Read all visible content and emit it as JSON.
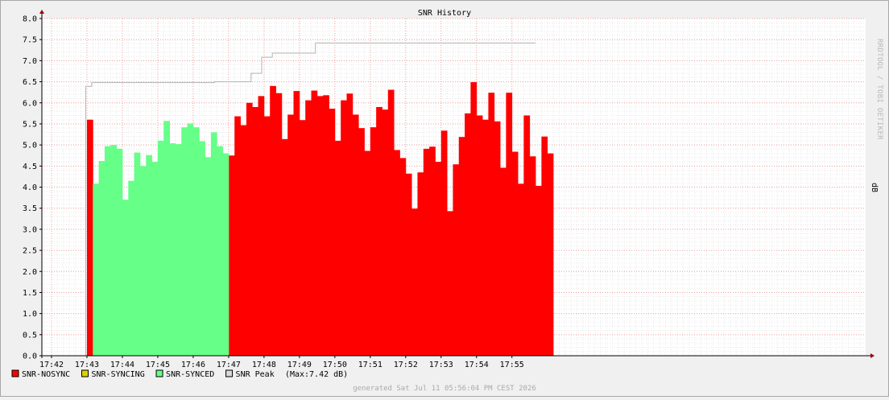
{
  "chart_data": {
    "type": "area",
    "title": "SNR History",
    "ylabel": "dB",
    "watermark": "RRDTOOL / TOBI OETIKER",
    "ylim": [
      0,
      8
    ],
    "yticks": [
      "0.0",
      "0.5",
      "1.0",
      "1.5",
      "2.0",
      "2.5",
      "3.0",
      "3.5",
      "4.0",
      "4.5",
      "5.0",
      "5.5",
      "6.0",
      "6.5",
      "7.0",
      "7.5",
      "8.0"
    ],
    "xticks": [
      "17:42",
      "17:43",
      "17:44",
      "17:45",
      "17:46",
      "17:47",
      "17:48",
      "17:49",
      "17:50",
      "17:51",
      "17:52",
      "17:53",
      "17:54",
      "17:55"
    ],
    "grid": true,
    "x_unit_seconds": 10,
    "series": [
      {
        "name": "SNR-NOSYNC",
        "color": "#ff0000",
        "segments": [
          {
            "start": 6,
            "values": [
              5.6
            ]
          },
          {
            "start": 30,
            "values": [
              4.75,
              5.68,
              5.47,
              6.0,
              5.9,
              6.16,
              5.68,
              6.4,
              6.23,
              5.14,
              5.72,
              6.28,
              5.59,
              6.06,
              6.29,
              6.16,
              6.18,
              5.86,
              5.1,
              6.06,
              6.22,
              5.72,
              5.4,
              4.86,
              5.42,
              5.9,
              5.84,
              6.31,
              4.88,
              4.69,
              4.32,
              3.49,
              4.35,
              4.91,
              4.96,
              4.6,
              5.34,
              3.43,
              4.54,
              5.19,
              5.75,
              6.49,
              5.7,
              5.6,
              6.24,
              5.56,
              4.46,
              6.24,
              4.84,
              4.08,
              5.7,
              4.73,
              4.03,
              5.2,
              4.8
            ]
          }
        ]
      },
      {
        "name": "SNR-SYNCING",
        "color": "#e0d000",
        "segments": []
      },
      {
        "name": "SNR-SYNCED",
        "color": "#66ff88",
        "segments": [
          {
            "start": 7,
            "values": [
              4.08,
              4.62,
              4.97,
              5.0,
              4.91,
              3.7,
              4.15,
              4.82,
              4.5,
              4.76,
              4.6,
              5.1,
              5.57,
              5.04,
              5.02,
              5.42,
              5.51,
              5.42,
              5.09,
              4.71,
              5.3,
              4.97,
              4.8
            ]
          }
        ]
      },
      {
        "name": "SNR Peak",
        "color": "#b4b4b4",
        "steps": [
          [
            5.8,
            6.39
          ],
          [
            6.8,
            6.48
          ],
          [
            27.6,
            6.5
          ],
          [
            33.8,
            6.7
          ],
          [
            35.6,
            7.08
          ],
          [
            37.4,
            7.18
          ],
          [
            44.7,
            7.42
          ],
          [
            82,
            7.42
          ]
        ]
      }
    ],
    "legend": [
      {
        "label": "SNR-NOSYNC",
        "color": "#ff0000",
        "note": ""
      },
      {
        "label": "SNR-SYNCING",
        "color": "#e0d000",
        "note": ""
      },
      {
        "label": "SNR-SYNCED",
        "color": "#66ff88",
        "note": ""
      },
      {
        "label": "SNR Peak",
        "color": "#d8d8d8",
        "note": "(Max:7.42 dB)"
      }
    ],
    "footer": "generated Sat Jul 11 05:56:04 PM CEST 2026"
  }
}
